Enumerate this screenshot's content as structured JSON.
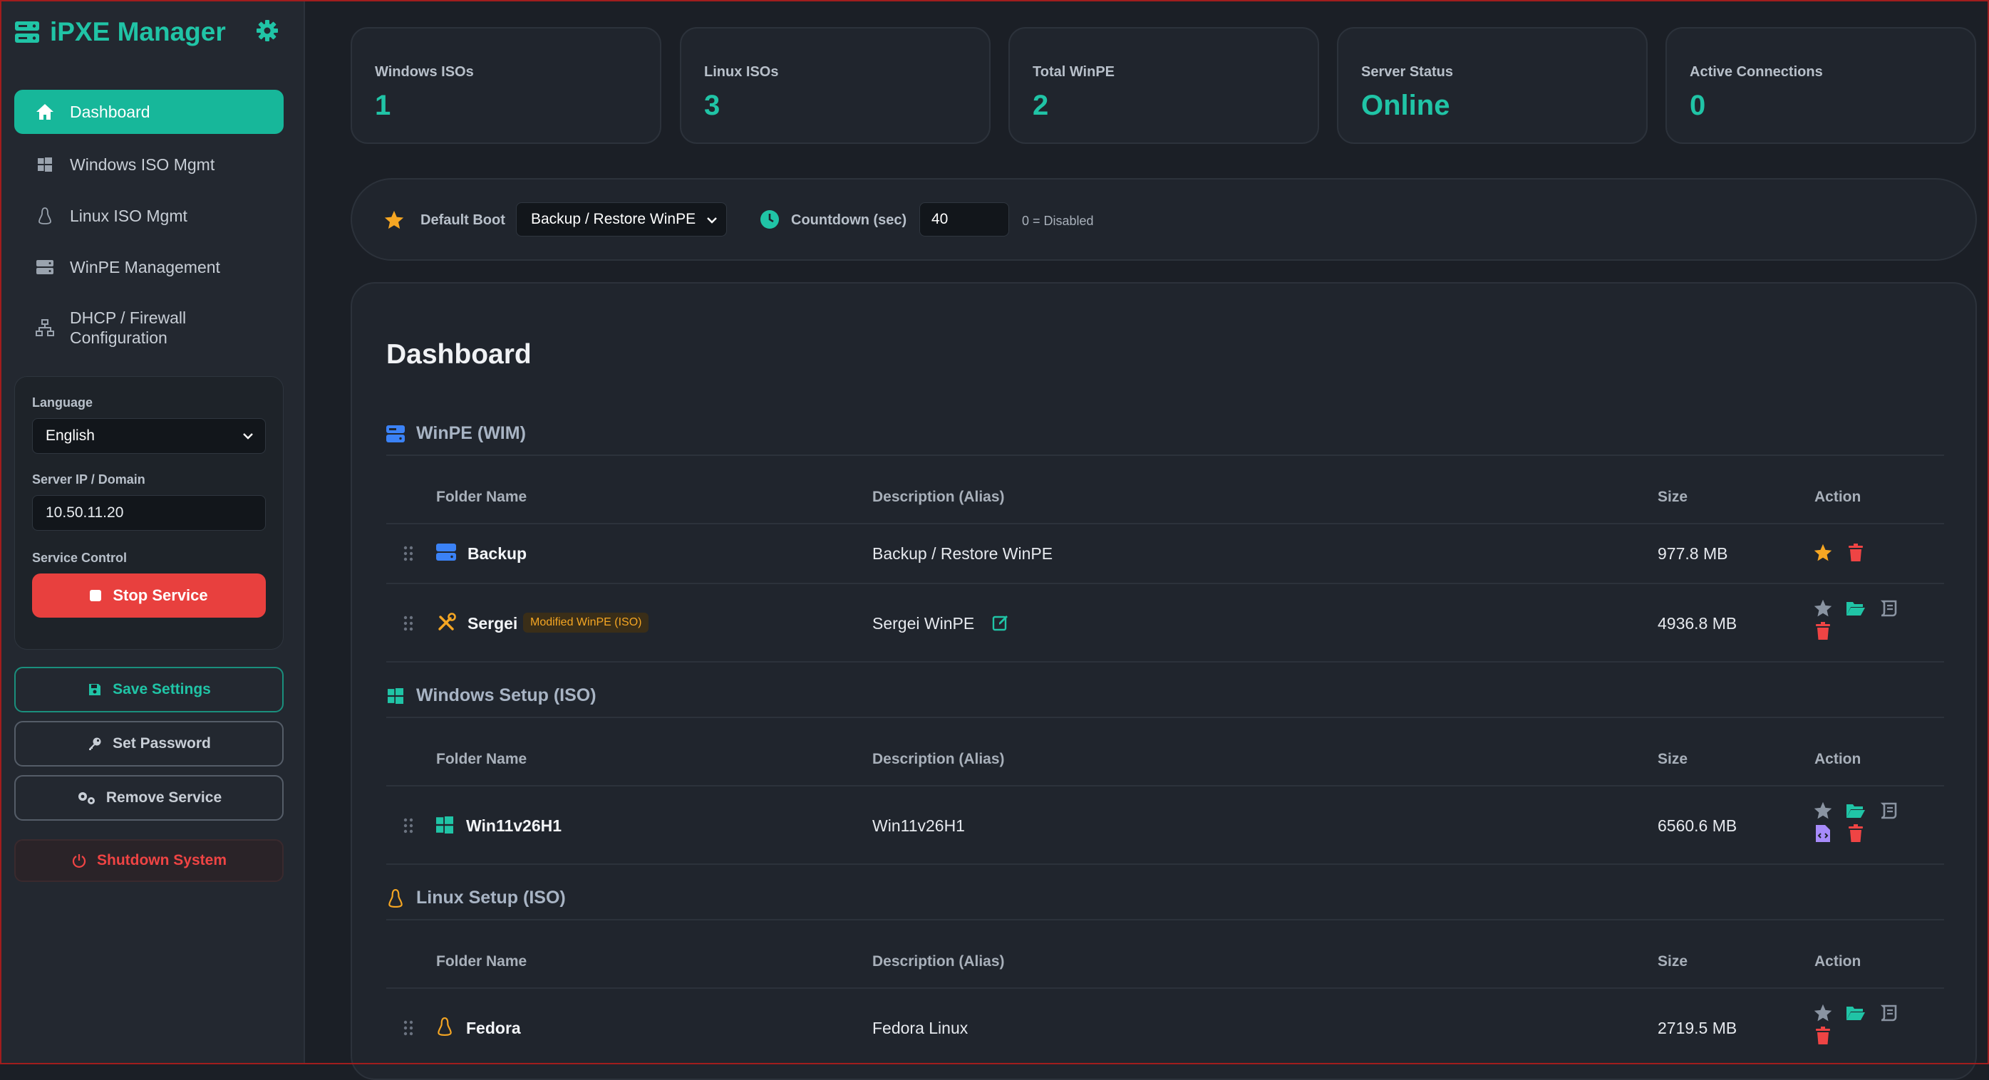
{
  "app": {
    "title": "iPXE Manager"
  },
  "colors": {
    "accent": "#20c4a6",
    "danger": "#e8403e",
    "warning": "#f5a623",
    "background": "#1b1f26"
  },
  "sidebar": {
    "nav": [
      {
        "label": "Dashboard",
        "icon": "home-icon",
        "active": true
      },
      {
        "label": "Windows ISO Mgmt",
        "icon": "windows-icon"
      },
      {
        "label": "Linux ISO Mgmt",
        "icon": "linux-icon"
      },
      {
        "label": "WinPE Management",
        "icon": "server-icon"
      },
      {
        "label": "DHCP / Firewall Configuration",
        "icon": "network-icon"
      }
    ],
    "settings": {
      "language_label": "Language",
      "language_value": "English",
      "server_label": "Server IP / Domain",
      "server_value": "10.50.11.20",
      "service_label": "Service Control",
      "stop_label": "Stop Service"
    },
    "buttons": {
      "save": "Save Settings",
      "password": "Set Password",
      "remove": "Remove Service",
      "shutdown": "Shutdown System"
    }
  },
  "stats": [
    {
      "label": "Windows ISOs",
      "value": "1"
    },
    {
      "label": "Linux ISOs",
      "value": "3"
    },
    {
      "label": "Total WinPE",
      "value": "2"
    },
    {
      "label": "Server Status",
      "value": "Online"
    },
    {
      "label": "Active Connections",
      "value": "0"
    }
  ],
  "boot": {
    "default_label": "Default Boot",
    "default_value": "Backup / Restore WinPE",
    "countdown_label": "Countdown (sec)",
    "countdown_value": "40",
    "countdown_hint": "0 = Disabled"
  },
  "dashboard": {
    "title": "Dashboard",
    "columns": {
      "folder": "Folder Name",
      "desc": "Description (Alias)",
      "size": "Size",
      "action": "Action"
    },
    "winpe": {
      "title": "WinPE (WIM)",
      "rows": [
        {
          "name": "Backup",
          "desc": "Backup / Restore WinPE",
          "size": "977.8 MB"
        },
        {
          "name": "Sergei",
          "badge": "Modified WinPE (ISO)",
          "desc": "Sergei WinPE",
          "size": "4936.8 MB"
        }
      ]
    },
    "windows": {
      "title": "Windows Setup (ISO)",
      "rows": [
        {
          "name": "Win11v26H1",
          "desc": "Win11v26H1",
          "size": "6560.6 MB"
        }
      ]
    },
    "linux": {
      "title": "Linux Setup (ISO)",
      "rows": [
        {
          "name": "Fedora",
          "desc": "Fedora Linux",
          "size": "2719.5 MB"
        }
      ]
    }
  }
}
